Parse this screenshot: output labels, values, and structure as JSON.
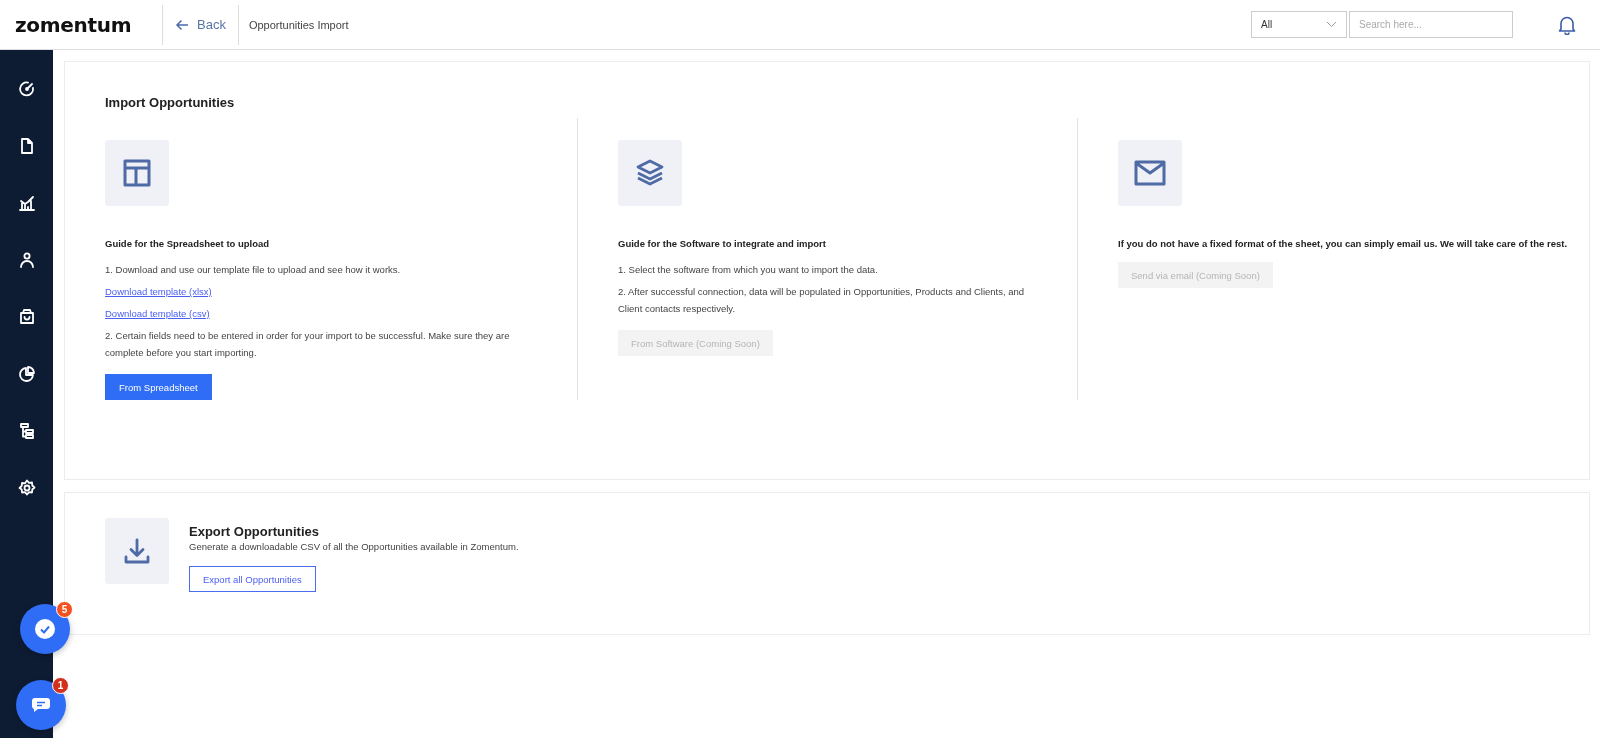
{
  "header": {
    "logo": "zomentum",
    "back": "Back",
    "page_title": "Opportunities Import",
    "filter": {
      "value": "All"
    },
    "search": {
      "placeholder": "Search here..."
    }
  },
  "import": {
    "title": "Import Opportunities",
    "columns": [
      {
        "kind": "layout",
        "heading": "Guide for the Spreadsheet to upload",
        "items": [
          {
            "kind": "text",
            "text": "1. Download and use our template file to upload and see how it works."
          },
          {
            "kind": "link",
            "text": "Download template (xlsx)"
          },
          {
            "kind": "link",
            "text": "Download template (csv)"
          },
          {
            "kind": "text",
            "text": "2. Certain fields need to be entered in order for your import to be successful. Make sure they are complete before you start importing."
          }
        ],
        "button": {
          "label": "From Spreadsheet",
          "disabled": false
        }
      },
      {
        "kind": "layers",
        "heading": "Guide for the Software to integrate and import",
        "items": [
          {
            "kind": "text",
            "text": "1. Select the software from which you want to import the data."
          },
          {
            "kind": "text",
            "text": "2. After successful connection, data will be populated in Opportunities, Products and Clients, and Client contacts respectively."
          }
        ],
        "button": {
          "label": "From Software (Coming Soon)",
          "disabled": true
        }
      },
      {
        "kind": "mail",
        "heading": "If you do not have a fixed format of the sheet, you can simply email us. We will take care of the rest.",
        "button": {
          "label": "Send via email (Coming Soon)",
          "disabled": true
        }
      }
    ]
  },
  "export": {
    "title": "Export Opportunities",
    "description": "Generate a downloadable CSV of all the Opportunities available in Zomentum.",
    "button": "Export all Opportunities"
  },
  "floating": [
    {
      "kind": "check",
      "badge": "5",
      "color": "#f4511e"
    },
    {
      "kind": "chat",
      "badge": "1",
      "color": "#d0301c"
    }
  ]
}
